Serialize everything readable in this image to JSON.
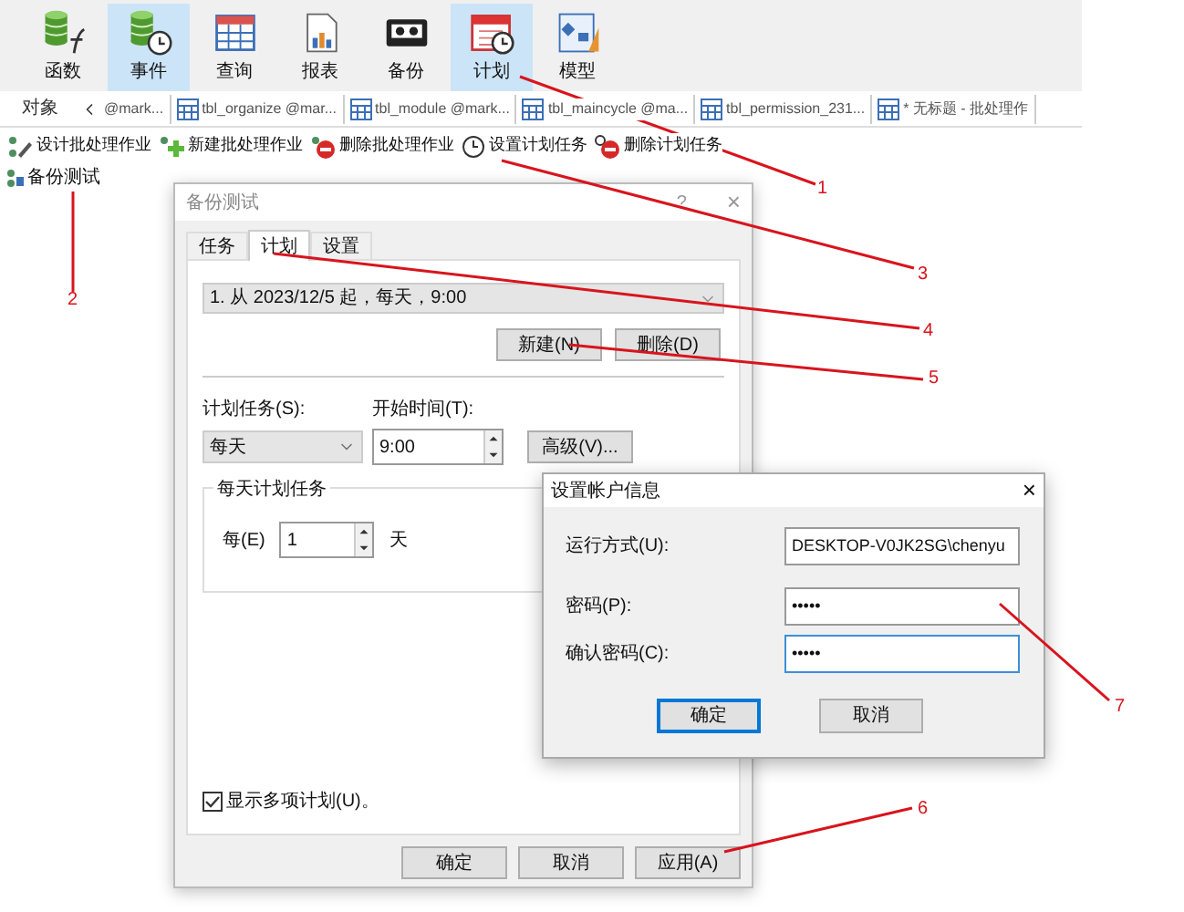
{
  "ribbon": [
    {
      "label": "函数",
      "selected": false
    },
    {
      "label": "事件",
      "selected": true
    },
    {
      "label": "查询",
      "selected": false
    },
    {
      "label": "报表",
      "selected": false
    },
    {
      "label": "备份",
      "selected": false
    },
    {
      "label": "计划",
      "selected": true
    },
    {
      "label": "模型",
      "selected": false
    }
  ],
  "object_bar": {
    "label": "对象",
    "tabs": [
      {
        "label": "@mark..."
      },
      {
        "label": "tbl_organize @mar..."
      },
      {
        "label": "tbl_module @mark..."
      },
      {
        "label": "tbl_maincycle @ma..."
      },
      {
        "label": "tbl_permission_231..."
      },
      {
        "label": "* 无标题 - 批处理作"
      }
    ]
  },
  "toolbar": [
    {
      "label": "设计批处理作业"
    },
    {
      "label": "新建批处理作业"
    },
    {
      "label": "删除批处理作业"
    },
    {
      "label": "设置计划任务"
    },
    {
      "label": "删除计划任务"
    }
  ],
  "tree": [
    {
      "label": "备份测试"
    }
  ],
  "dialog": {
    "title": "备份测试",
    "help": "?",
    "close": "×",
    "tabs": [
      {
        "label": "任务",
        "selected": false
      },
      {
        "label": "计划",
        "selected": true
      },
      {
        "label": "设置",
        "selected": false
      }
    ],
    "schedule_list": "1. 从 2023/12/5 起，每天，9:00",
    "list_buttons": [
      "新建(N)",
      "删除(D)"
    ],
    "schedule_task_label": "计划任务(S):",
    "schedule_task_value": "每天",
    "start_time_label": "开始时间(T):",
    "start_time_value": "9:00",
    "advanced_button": "高级(V)...",
    "group": {
      "title": "每天计划任务",
      "every_label": "每(E)",
      "every_value": "1",
      "unit": "天"
    },
    "show_multiple": {
      "label": "显示多项计划(U)。",
      "checked": true
    },
    "buttons": [
      "确定",
      "取消",
      "应用(A)"
    ]
  },
  "account_dialog": {
    "title": "设置帐户信息",
    "close": "×",
    "fields": [
      {
        "label": "运行方式(U):",
        "value": "DESKTOP-V0JK2SG\\chenyu",
        "focused": false
      },
      {
        "label": "密码(P):",
        "value": "•••••",
        "focused": false
      },
      {
        "label": "确认密码(C):",
        "value": "•••••",
        "focused": true
      }
    ],
    "buttons": [
      {
        "label": "确定",
        "default": true
      },
      {
        "label": "取消",
        "default": false
      }
    ]
  },
  "annotations": [
    {
      "label": "1"
    },
    {
      "label": "2"
    },
    {
      "label": "3"
    },
    {
      "label": "4"
    },
    {
      "label": "5"
    },
    {
      "label": "6"
    },
    {
      "label": "7"
    }
  ]
}
